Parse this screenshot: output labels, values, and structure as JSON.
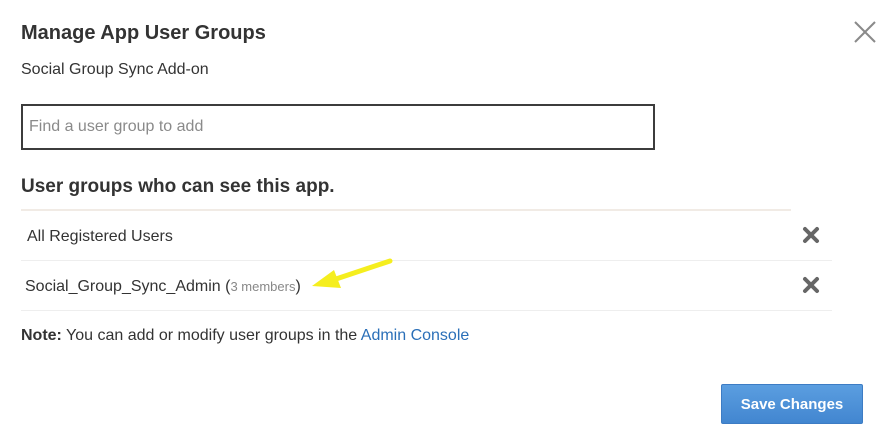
{
  "dialog": {
    "title": "Manage App User Groups",
    "subtitle": "Social Group Sync Add-on",
    "close_icon": "close-icon"
  },
  "search": {
    "placeholder": "Find a user group to add",
    "value": ""
  },
  "groups_section": {
    "heading": "User groups who can see this app.",
    "items": [
      {
        "name": "All Registered Users",
        "members": "",
        "remove_icon": "remove-x-icon"
      },
      {
        "name": "Social_Group_Sync_Admin",
        "members": "3 members",
        "remove_icon": "remove-x-icon"
      }
    ]
  },
  "annotation": {
    "arrow_icon": "yellow-arrow-icon",
    "arrow_color": "#f5ee1e"
  },
  "note": {
    "label": "Note:",
    "text": " You can add or modify user groups in the ",
    "link": "Admin Console"
  },
  "footer": {
    "save_label": "Save Changes"
  },
  "colors": {
    "accent": "#4a8fd6",
    "link": "#2a6fb8",
    "text": "#333333"
  }
}
